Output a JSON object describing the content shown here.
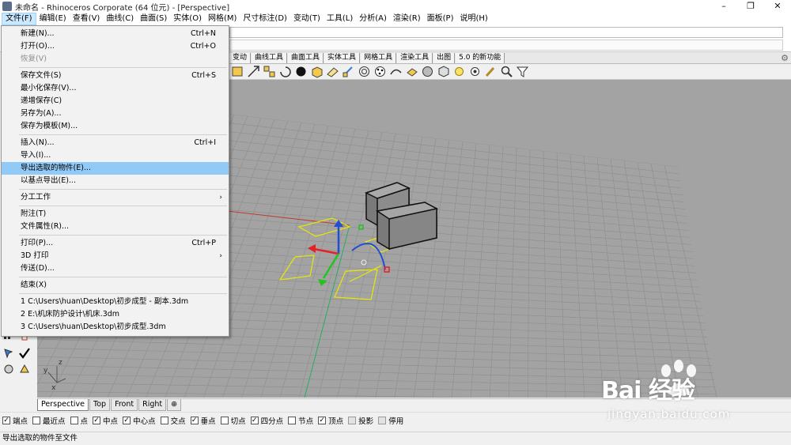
{
  "window": {
    "title": "未命名 - Rhinoceros Corporate (64 位元) - [Perspective]",
    "minimize": "–",
    "maximize": "❐",
    "close": "✕"
  },
  "menubar": [
    "文件(F)",
    "编辑(E)",
    "查看(V)",
    "曲线(C)",
    "曲面(S)",
    "实体(O)",
    "网格(M)",
    "尺寸标注(D)",
    "变动(T)",
    "工具(L)",
    "分析(A)",
    "渲染(R)",
    "面板(P)",
    "说明(H)"
  ],
  "toolbar_tabs": [
    "变动",
    "曲线工具",
    "曲面工具",
    "实体工具",
    "网格工具",
    "渲染工具",
    "出图",
    "5.0 的新功能"
  ],
  "file_menu": {
    "new": {
      "label": "新建(N)...",
      "shortcut": "Ctrl+N"
    },
    "open": {
      "label": "打开(O)...",
      "shortcut": "Ctrl+O"
    },
    "revert": {
      "label": "恢复(V)"
    },
    "save": {
      "label": "保存文件(S)",
      "shortcut": "Ctrl+S"
    },
    "save_small": {
      "label": "最小化保存(V)..."
    },
    "incremental_save": {
      "label": "递增保存(C)"
    },
    "save_as": {
      "label": "另存为(A)..."
    },
    "save_template": {
      "label": "保存为模板(M)..."
    },
    "insert": {
      "label": "插入(N)...",
      "shortcut": "Ctrl+I"
    },
    "import": {
      "label": "导入(I)..."
    },
    "export_selected": {
      "label": "导出选取的物件(E)..."
    },
    "export_base": {
      "label": "以基点导出(E)..."
    },
    "worksession": {
      "label": "分工工作"
    },
    "notes": {
      "label": "附注(T)"
    },
    "properties": {
      "label": "文件属性(R)..."
    },
    "print": {
      "label": "打印(P)...",
      "shortcut": "Ctrl+P"
    },
    "print3d": {
      "label": "3D 打印"
    },
    "send": {
      "label": "传送(D)..."
    },
    "exit": {
      "label": "结束(X)"
    },
    "recent": [
      "1 C:\\Users\\huan\\Desktop\\初步成型 - 副本.3dm",
      "2 E:\\机床防护设计\\机床.3dm",
      "3 C:\\Users\\huan\\Desktop\\初步成型.3dm"
    ]
  },
  "viewport_tabs": [
    "Perspective",
    "Top",
    "Front",
    "Right",
    "⊕"
  ],
  "osnaps": [
    {
      "label": "端点",
      "checked": true
    },
    {
      "label": "最近点",
      "checked": false
    },
    {
      "label": "点",
      "checked": false
    },
    {
      "label": "中点",
      "checked": true
    },
    {
      "label": "中心点",
      "checked": true
    },
    {
      "label": "交点",
      "checked": false
    },
    {
      "label": "垂点",
      "checked": true
    },
    {
      "label": "切点",
      "checked": false
    },
    {
      "label": "四分点",
      "checked": true
    },
    {
      "label": "节点",
      "checked": false
    },
    {
      "label": "顶点",
      "checked": true
    },
    {
      "label": "投影",
      "checked": false,
      "disabled": true
    },
    {
      "label": "停用",
      "checked": false,
      "disabled": true
    }
  ],
  "status": "导出选取的物件至文件",
  "axis_labels": {
    "z": "z",
    "y": "y",
    "x": "x"
  },
  "watermark": {
    "logo": "Bai 经验",
    "url": "jingyan.baidu.com"
  },
  "colors": {
    "highlight": "#91c9f7",
    "viewport": "#a3a3a3",
    "x_axis": "#c0392b",
    "y_axis": "#27ae60",
    "selection": "#e8e800"
  }
}
